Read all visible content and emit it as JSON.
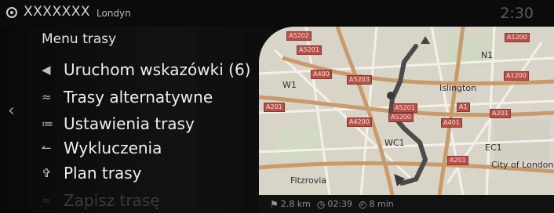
{
  "header": {
    "destination": "XXXXXXX",
    "city": "Londyn",
    "time": "2:30"
  },
  "menu": {
    "title": "Menu trasy",
    "items": [
      {
        "label": "Uruchom wskazówki (6)",
        "icon": "navigation-arrow-icon"
      },
      {
        "label": "Trasy alternatywne",
        "icon": "alternative-routes-icon"
      },
      {
        "label": "Ustawienia trasy",
        "icon": "route-settings-icon"
      },
      {
        "label": "Wykluczenia",
        "icon": "avoid-icon"
      },
      {
        "label": "Plan trasy",
        "icon": "route-plan-icon"
      },
      {
        "label": "Zapisz trasę",
        "icon": "save-route-icon"
      }
    ]
  },
  "map": {
    "labels": [
      "N1",
      "Islington",
      "W1",
      "EC1",
      "City of London",
      "Fitzrovia",
      "WC1"
    ],
    "road_labels": [
      "A5202",
      "A5201",
      "A400",
      "A5203",
      "A1",
      "A1200",
      "A1200",
      "A5200",
      "A201",
      "A401",
      "A4200",
      "A5201",
      "A201",
      "A201"
    ]
  },
  "status": {
    "distance": "2.8 km",
    "eta": "02:39",
    "duration": "8 min"
  },
  "colors": {
    "route": "#555555",
    "road_label_bg": "#b8504a",
    "map_bg": "#d9d4c8"
  }
}
